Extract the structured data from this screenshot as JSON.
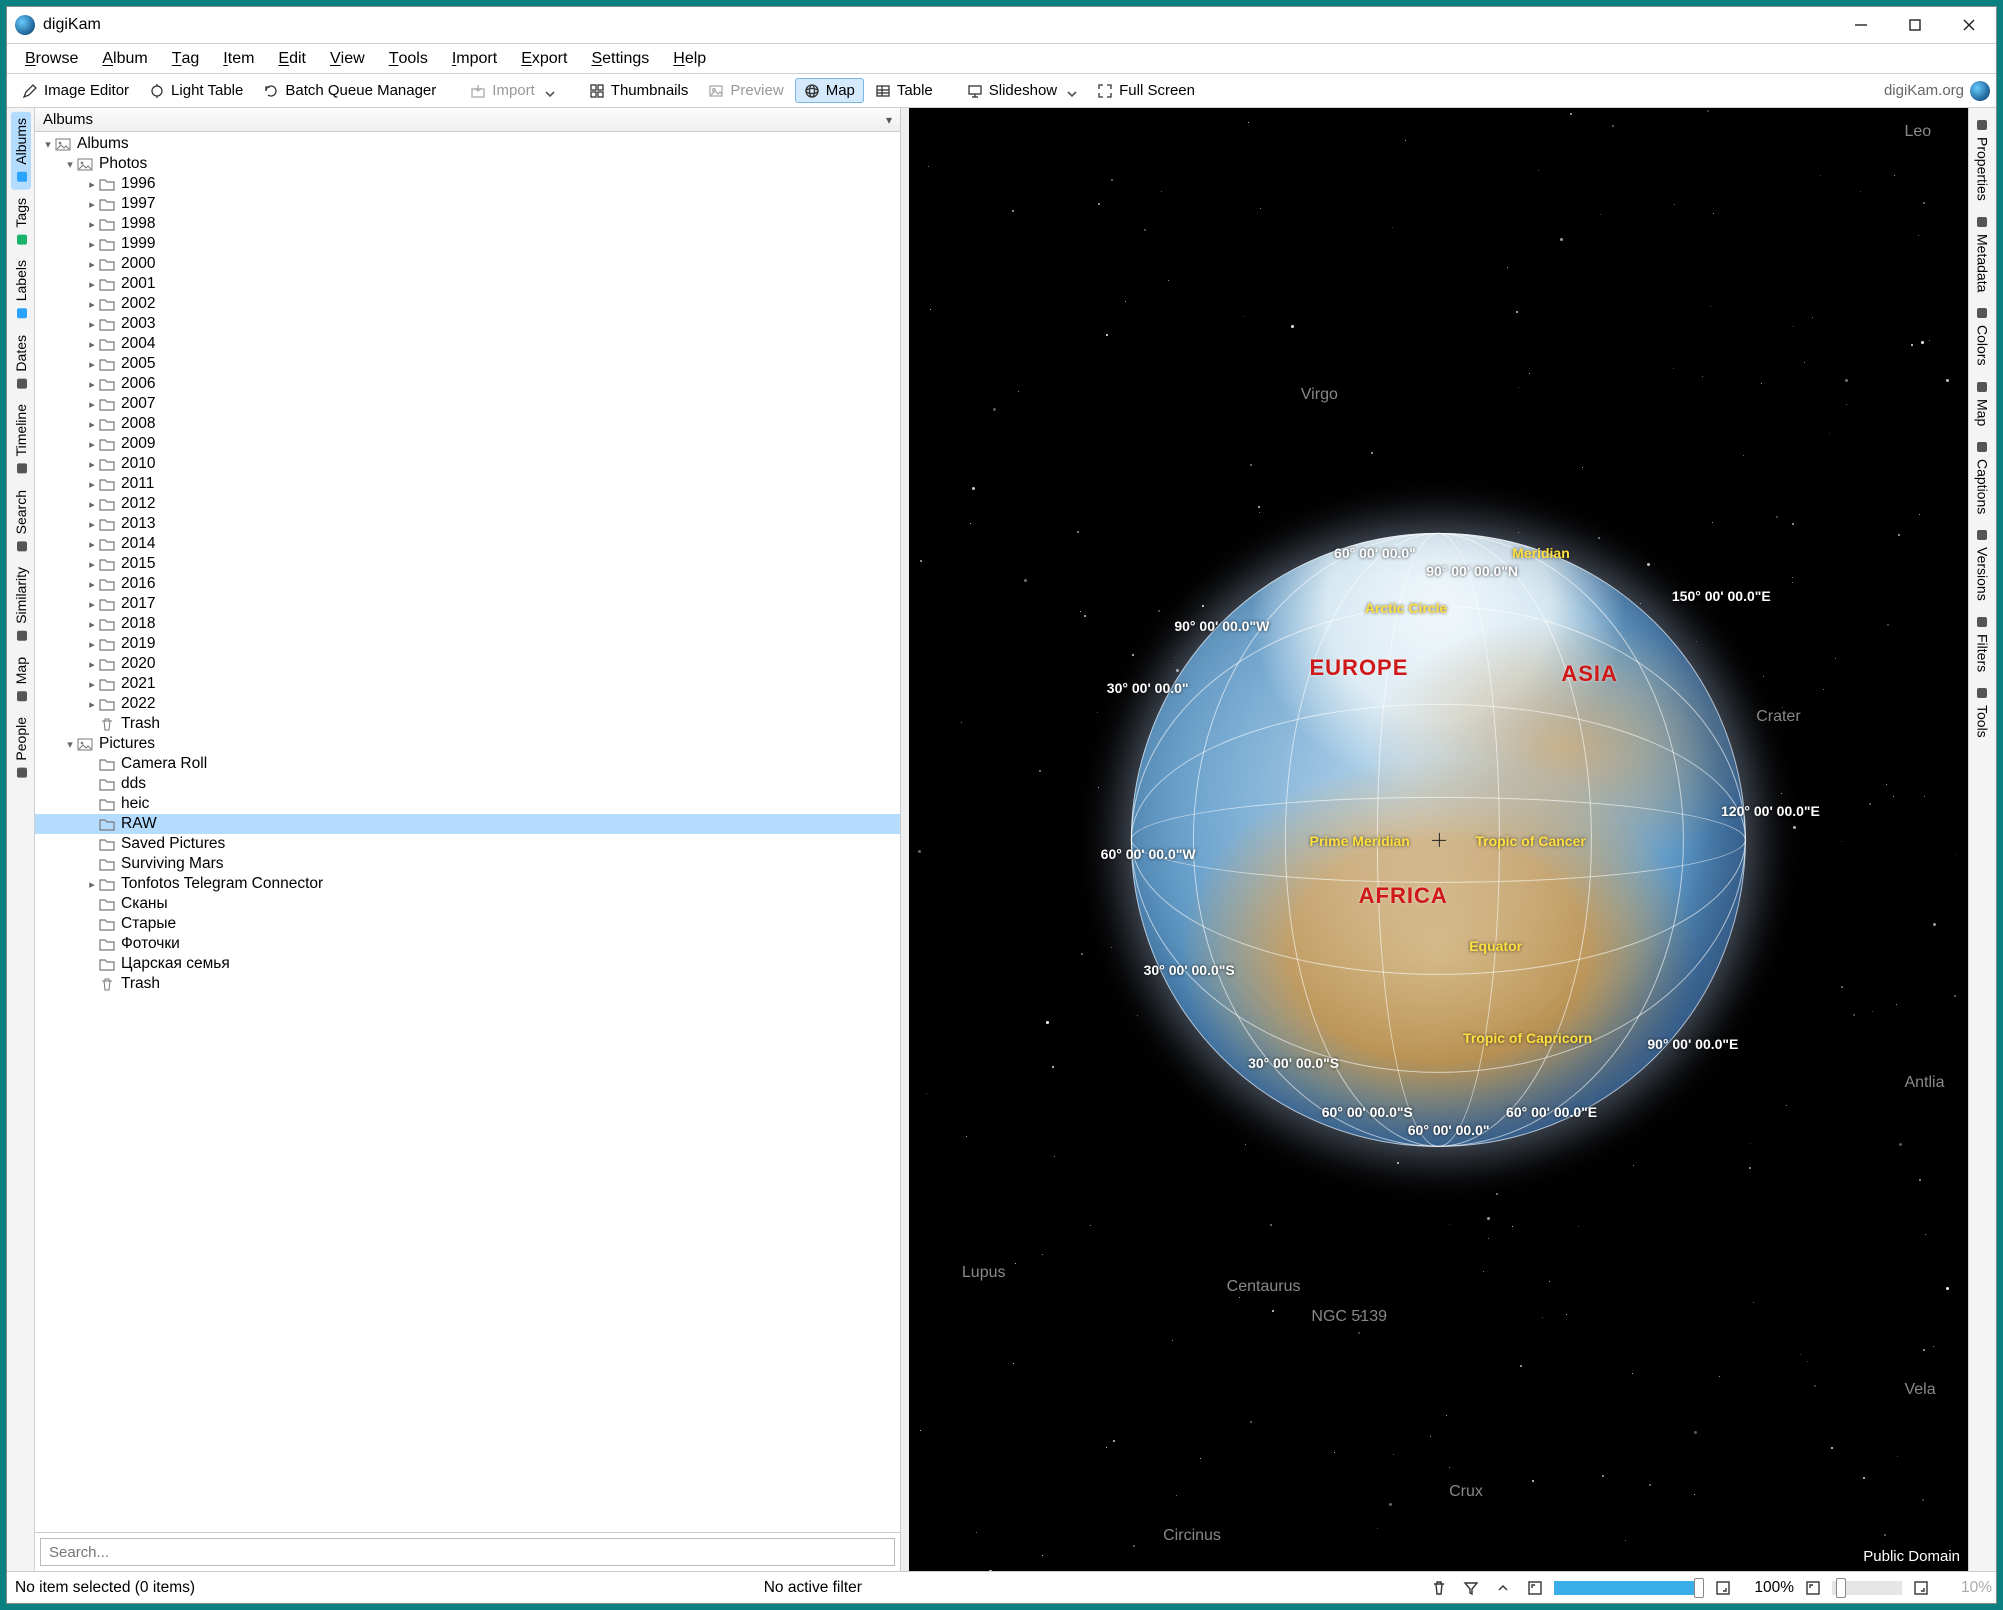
{
  "app": {
    "title": "digiKam",
    "brand": "digiKam.org"
  },
  "menubar": {
    "items": [
      {
        "label": "Browse",
        "accel": "B"
      },
      {
        "label": "Album",
        "accel": "A"
      },
      {
        "label": "Tag",
        "accel": "T"
      },
      {
        "label": "Item",
        "accel": "I"
      },
      {
        "label": "Edit",
        "accel": "E"
      },
      {
        "label": "View",
        "accel": "V"
      },
      {
        "label": "Tools",
        "accel": "T"
      },
      {
        "label": "Import",
        "accel": "I"
      },
      {
        "label": "Export",
        "accel": "E"
      },
      {
        "label": "Settings",
        "accel": "S"
      },
      {
        "label": "Help",
        "accel": "H"
      }
    ]
  },
  "toolbar": {
    "image_editor": "Image Editor",
    "light_table": "Light Table",
    "batch_queue": "Batch Queue Manager",
    "import": "Import",
    "thumbnails": "Thumbnails",
    "preview": "Preview",
    "map": "Map",
    "table": "Table",
    "slideshow": "Slideshow",
    "fullscreen": "Full Screen"
  },
  "left_tabs": [
    "Albums",
    "Tags",
    "Labels",
    "Dates",
    "Timeline",
    "Search",
    "Similarity",
    "Map",
    "People"
  ],
  "right_tabs": [
    "Properties",
    "Metadata",
    "Colors",
    "Map",
    "Captions",
    "Versions",
    "Filters",
    "Tools"
  ],
  "tree": {
    "header": "Albums",
    "root": "Albums",
    "photos_label": "Photos",
    "photos_years": [
      "1996",
      "1997",
      "1998",
      "1999",
      "2000",
      "2001",
      "2002",
      "2003",
      "2004",
      "2005",
      "2006",
      "2007",
      "2008",
      "2009",
      "2010",
      "2011",
      "2012",
      "2013",
      "2014",
      "2015",
      "2016",
      "2017",
      "2018",
      "2019",
      "2020",
      "2021",
      "2022"
    ],
    "photos_trash": "Trash",
    "pictures_label": "Pictures",
    "pictures_children": [
      {
        "label": "Camera Roll",
        "expandable": false
      },
      {
        "label": "dds",
        "expandable": false
      },
      {
        "label": "heic",
        "expandable": false
      },
      {
        "label": "RAW",
        "expandable": false,
        "selected": true
      },
      {
        "label": "Saved Pictures",
        "expandable": false
      },
      {
        "label": "Surviving Mars",
        "expandable": false
      },
      {
        "label": "Tonfotos Telegram Connector",
        "expandable": true
      },
      {
        "label": "Сканы",
        "expandable": false
      },
      {
        "label": "Старые",
        "expandable": false
      },
      {
        "label": "Фоточки",
        "expandable": false
      },
      {
        "label": "Царская семья",
        "expandable": false
      }
    ],
    "pictures_trash": "Trash",
    "search_placeholder": "Search..."
  },
  "map": {
    "attribution": "Public Domain",
    "continents": {
      "europe": "EUROPE",
      "asia": "ASIA",
      "africa": "AFRICA"
    },
    "tropics": {
      "arctic": "Arctic Circle",
      "cancer": "Tropic of Cancer",
      "prime": "Prime Meridian",
      "equator": "Equator",
      "capricorn": "Tropic of Capricorn",
      "meridian_top": "Meridian"
    },
    "coords": {
      "n90": "90° 00' 00.0\"N",
      "e150": "150° 00' 00.0\"E",
      "w90": "90° 00' 00.0\"W",
      "w60n": "60° 00' 00.0\"",
      "w30": "30° 00' 00.0\"",
      "w60": "60° 00' 00.0\"W",
      "e120": "120° 00' 00.0\"E",
      "s30": "30° 00' 00.0\"S",
      "s30b": "30° 00' 00.0\"S",
      "e90": "90° 00' 00.0\"E",
      "s60a": "60° 00' 00.0\"S",
      "s60b": "60° 00' 00.0\"",
      "e60": "60° 00' 00.0\"E"
    },
    "constellations": [
      "Leo",
      "Virgo",
      "Crater",
      "Antlia",
      "Lupus",
      "Centaurus",
      "NGC 5139",
      "Crux",
      "Circinus",
      "Vela"
    ]
  },
  "status": {
    "selection": "No item selected (0 items)",
    "filter": "No active filter",
    "zoom_main": "100%",
    "zoom_thumb": "10%"
  }
}
